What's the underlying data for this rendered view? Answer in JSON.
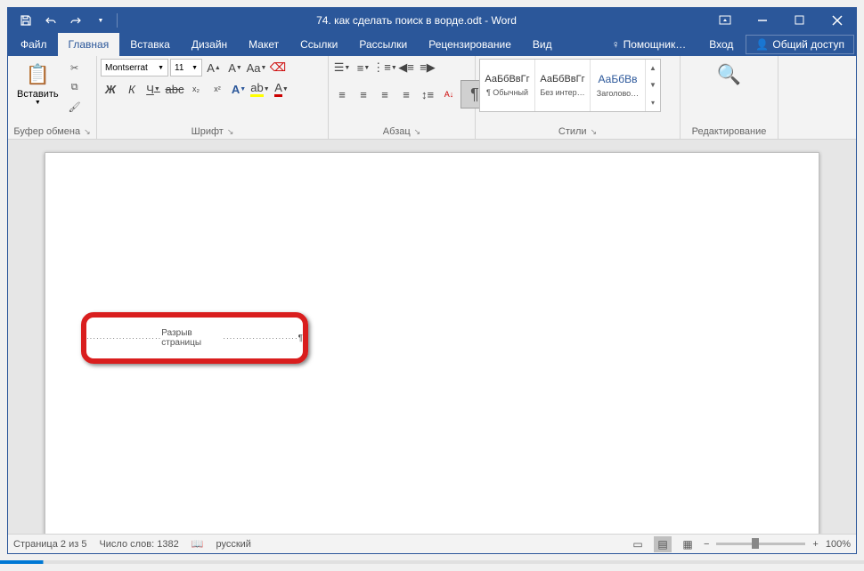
{
  "title": "74. как сделать поиск в ворде.odt - Word",
  "tabs": [
    "Файл",
    "Главная",
    "Вставка",
    "Дизайн",
    "Макет",
    "Ссылки",
    "Рассылки",
    "Рецензирование",
    "Вид"
  ],
  "active_tab": 1,
  "tell_me": "Помощник…",
  "sign_in": "Вход",
  "share": "Общий доступ",
  "ribbon": {
    "clipboard": {
      "paste": "Вставить",
      "label": "Буфер обмена"
    },
    "font": {
      "family": "Montserrat",
      "size": "11",
      "label": "Шрифт",
      "bold": "Ж",
      "italic": "К",
      "underline": "Ч",
      "strike": "abc",
      "sub": "x₂",
      "sup": "x²",
      "clear": "Aa",
      "effects": "A",
      "highlight": "A"
    },
    "paragraph": {
      "label": "Абзац",
      "pilcrow": "¶"
    },
    "styles": {
      "label": "Стили",
      "preview": "АаБбВвГг",
      "preview_heading": "АаБбВв",
      "items": [
        "¶ Обычный",
        "Без интер…",
        "Заголово…"
      ]
    },
    "editing": {
      "label": "Редактирование"
    }
  },
  "document": {
    "page_break": "Разрыв страницы",
    "pilcrow_mark": "¶"
  },
  "status": {
    "page": "Страница 2 из 5",
    "words_label": "Число слов:",
    "words": "1382",
    "language": "русский",
    "zoom": "100%"
  }
}
